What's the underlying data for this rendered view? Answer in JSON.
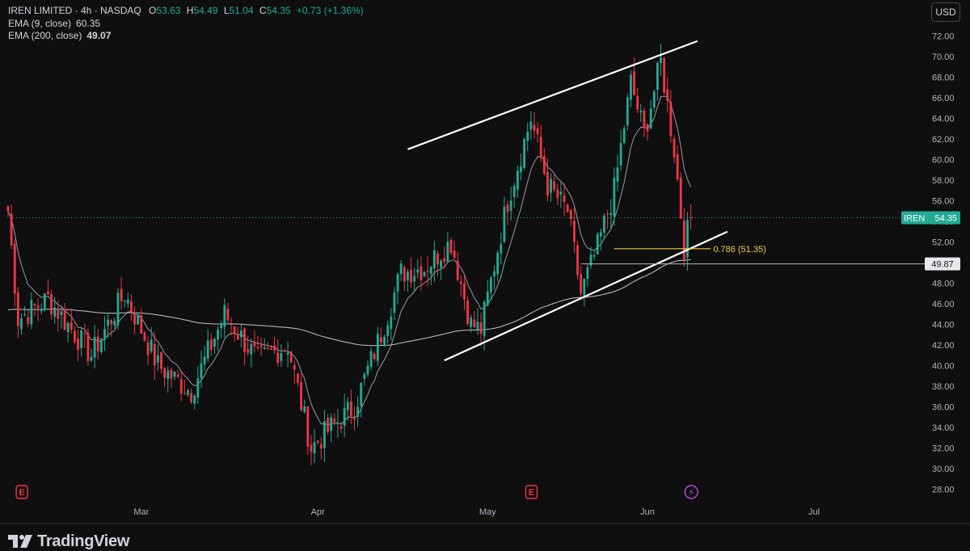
{
  "legend": {
    "symbol": "IREN LIMITED · 4h · NASDAQ",
    "open_label": "O",
    "open": "53.63",
    "high_label": "H",
    "high": "54.49",
    "low_label": "L",
    "low": "51.04",
    "close_label": "C",
    "close": "54.35",
    "change": "+0.73 (+1.36%)",
    "ema9_label": "EMA (9, close)",
    "ema9_value": "60.35",
    "ema200_label": "EMA (200, close)",
    "ema200_value": "49.07"
  },
  "currency": "USD",
  "brand": "TradingView",
  "colors": {
    "background": "#0f0f0f",
    "up": "#22ab94",
    "down": "#f23645",
    "fib": "#f7c948",
    "ema": "#b2b5be",
    "trendline": "#ffffff"
  },
  "chart_data": {
    "type": "candlestick",
    "symbol": "IREN",
    "timeframe": "4h",
    "exchange": "NASDAQ",
    "ylim": [
      28,
      72
    ],
    "y_ticks": [
      "72.00",
      "70.00",
      "68.00",
      "66.00",
      "64.00",
      "62.00",
      "60.00",
      "58.00",
      "56.00",
      "54.00",
      "52.00",
      "50.00",
      "48.00",
      "46.00",
      "44.00",
      "42.00",
      "40.00",
      "38.00",
      "36.00",
      "34.00",
      "32.00",
      "30.00",
      "28.00"
    ],
    "x_ticks": [
      {
        "label": "Mar",
        "index": 40
      },
      {
        "label": "Apr",
        "index": 93
      },
      {
        "label": "May",
        "index": 144
      },
      {
        "label": "Jun",
        "index": 192
      },
      {
        "label": "Jul",
        "index": 242
      }
    ],
    "bar_count": 290,
    "last_price": {
      "label": "IREN",
      "value": "54.35",
      "price": 54.35
    },
    "horizontal_level": {
      "value": "49.87",
      "price": 49.87
    },
    "fib_level": {
      "label": "0.786 (51.35)",
      "price": 51.35,
      "from_index": 182,
      "to_index": 211
    },
    "channel": {
      "upper": [
        {
          "index": 120,
          "price": 61.0
        },
        {
          "index": 207,
          "price": 71.5
        }
      ],
      "lower": [
        {
          "index": 131,
          "price": 40.5
        },
        {
          "index": 216,
          "price": 53.0
        }
      ]
    },
    "events": [
      {
        "type": "earnings",
        "label": "E",
        "index": 1
      },
      {
        "type": "earnings",
        "label": "E",
        "index": 154
      },
      {
        "type": "dividend-split",
        "label": "⚡",
        "index": 202
      }
    ],
    "key_points": [
      {
        "index": 0,
        "price": 55.0
      },
      {
        "index": 3,
        "price": 44.5
      },
      {
        "index": 12,
        "price": 46.5
      },
      {
        "index": 25,
        "price": 41.0
      },
      {
        "index": 35,
        "price": 47.0
      },
      {
        "index": 45,
        "price": 40.0
      },
      {
        "index": 55,
        "price": 37.5
      },
      {
        "index": 65,
        "price": 45.0
      },
      {
        "index": 75,
        "price": 40.5
      },
      {
        "index": 84,
        "price": 42.0
      },
      {
        "index": 91,
        "price": 32.0
      },
      {
        "index": 97,
        "price": 34.0
      },
      {
        "index": 104,
        "price": 36.0
      },
      {
        "index": 113,
        "price": 44.0
      },
      {
        "index": 118,
        "price": 49.0
      },
      {
        "index": 125,
        "price": 49.5
      },
      {
        "index": 133,
        "price": 52.0
      },
      {
        "index": 139,
        "price": 44.0
      },
      {
        "index": 142,
        "price": 43.5
      },
      {
        "index": 150,
        "price": 56.0
      },
      {
        "index": 157,
        "price": 64.0
      },
      {
        "index": 162,
        "price": 57.5
      },
      {
        "index": 168,
        "price": 55.0
      },
      {
        "index": 172,
        "price": 47.0
      },
      {
        "index": 177,
        "price": 51.5
      },
      {
        "index": 182,
        "price": 57.0
      },
      {
        "index": 187,
        "price": 67.5
      },
      {
        "index": 191,
        "price": 62.5
      },
      {
        "index": 196,
        "price": 69.5
      },
      {
        "index": 200,
        "price": 61.0
      },
      {
        "index": 201,
        "price": 58.0
      },
      {
        "index": 203,
        "price": 51.5
      },
      {
        "index": 205,
        "price": 54.35
      }
    ],
    "ema9_end": 60.35,
    "ema200_end": 49.07
  }
}
